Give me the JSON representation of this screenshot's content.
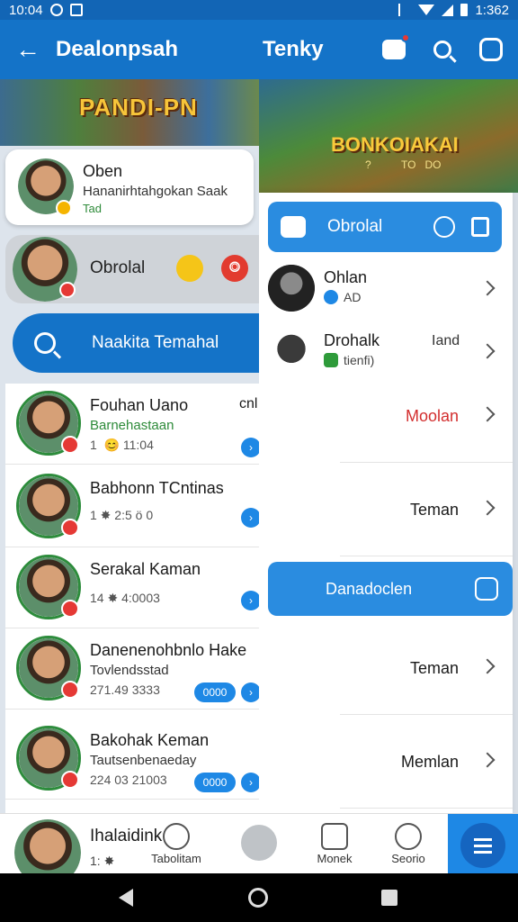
{
  "status_bar": {
    "time": "10:04",
    "battery_text": "1:362"
  },
  "app_bar": {
    "title": "Dealonpsah",
    "title_right": "Tenky"
  },
  "left_banner": {
    "text": "PANDI-PN"
  },
  "profile_card": {
    "name": "Oben",
    "subtitle": "Hananirhtahgokan Saak",
    "meta": "Tad"
  },
  "chat_card": {
    "label": "Obrolal",
    "action": "⭗"
  },
  "search_pill": {
    "label": "Naakita Temahal"
  },
  "chats": [
    {
      "name": "Fouhan Uano",
      "side": "cnl",
      "subtitle": "Barnehastaan",
      "time": "1  😊 11:04",
      "pill": ""
    },
    {
      "name": "Babhonn TCntinas",
      "side": "",
      "subtitle": "",
      "time": "1 ✸ 2:5 ö 0",
      "pill": ""
    },
    {
      "name": "Serakal Kaman",
      "side": "",
      "subtitle": "",
      "time": "14 ✸ 4:0003",
      "pill": ""
    },
    {
      "name": "Danenenohbnlo Hake",
      "side": "",
      "subtitle": "Tovlendsstad",
      "time": "271.49 3333",
      "pill": "0000"
    },
    {
      "name": "Bakohak Keman",
      "side": "",
      "subtitle": "Tautsenbenaeday",
      "time": "224 03 21003",
      "pill": "0000"
    }
  ],
  "right_banner": {
    "title": "BONKOIAKAI",
    "sub": "?          TO   DO"
  },
  "sheet": {
    "header_label": "Obrolal",
    "contacts": [
      {
        "name": "Ohlan",
        "sub": "AD",
        "right": ""
      },
      {
        "name": "Drohalk",
        "sub": "tienfi)",
        "right": "Iand"
      }
    ],
    "menu_items": [
      {
        "label": "Moolan",
        "color": "#d32f2f"
      },
      {
        "label": "Teman",
        "color": "#222222"
      }
    ],
    "blue_item_label": "Danadoclen",
    "menu_items_lower": [
      {
        "label": "Teman"
      },
      {
        "label": "Memlan"
      }
    ]
  },
  "bottom_nav": {
    "user_name": "Ihalaidink",
    "user_sub": "1: ✸",
    "tabs": [
      {
        "label": "Tabolitam"
      },
      {
        "label": ""
      },
      {
        "label": "Monek"
      },
      {
        "label": "Seorio"
      }
    ]
  },
  "colors": {
    "primary": "#1473c8",
    "accent": "#2a8ce0",
    "badge_red": "#e53935"
  }
}
